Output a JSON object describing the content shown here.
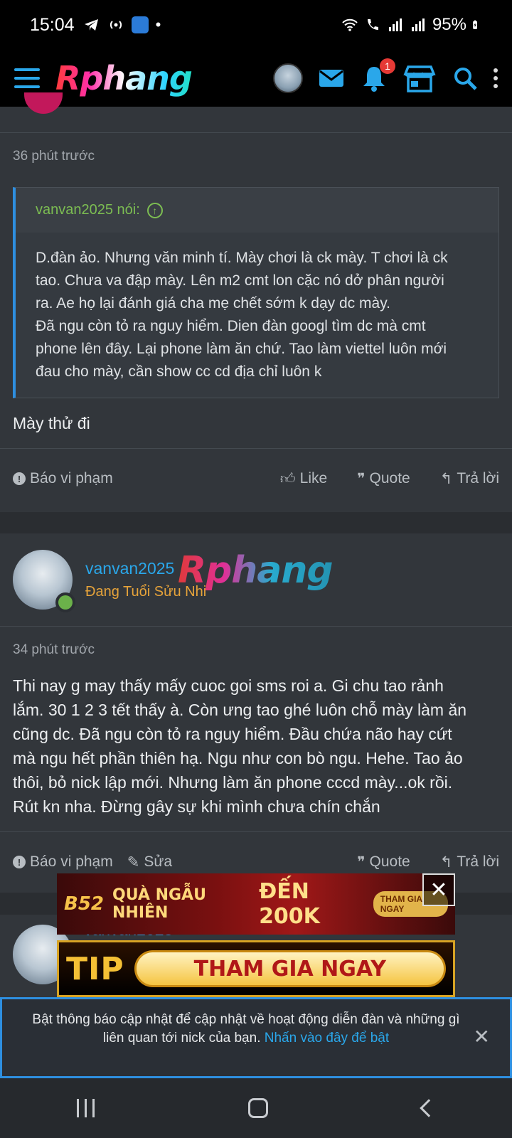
{
  "status_bar": {
    "time": "15:04",
    "battery": "95%"
  },
  "header": {
    "logo": "Rphang",
    "notification_count": "1"
  },
  "post1": {
    "time": "36 phút trước",
    "quote_author": "vanvan2025 nói:",
    "quote_lines": [
      "D.đàn ảo. Nhưng văn minh tí. Mày chơi là ck mày. T chơi là ck",
      "tao. Chưa va đập mày. Lên m2 cmt lon cặc nó dở phân người",
      "ra. Ae họ lại đánh giá cha mẹ chết sớm k dạy dc mày.",
      "Đã ngu còn tỏ ra nguy hiểm. Dien đàn googl tìm dc mà cmt",
      "phone lên đây. Lại phone làm ăn chứ. Tao làm viettel luôn mới",
      "đau cho mày, cần show cc cd địa chỉ luôn k"
    ],
    "message": "Mày thử đi",
    "report": "Báo vi phạm",
    "like": "Like",
    "quote": "Quote",
    "reply": "Trả lời"
  },
  "post2": {
    "username": "vanvan2025",
    "user_title": "Đang Tuổi Sửu Nhi",
    "watermark": "Rphang",
    "time": "34 phút trước",
    "message_lines": [
      "Thi nay g may thấy mấy cuoc goi sms roi a. Gi chu tao rảnh",
      "lắm. 30 1 2 3 tết thấy à. Còn ưng tao ghé luôn chỗ mày làm ăn",
      "cũng dc. Đã ngu còn tỏ ra nguy hiểm. Đầu chứa não hay cứt",
      "mà ngu hết phần thiên hạ. Ngu như con bò ngu. Hehe. Tao ảo",
      "thôi, bỏ nick lập mới. Nhưng làm ăn phone cccd mày...ok rồi.",
      "Rút kn nha. Đừng gây sự khi mình chưa chín chắn"
    ],
    "report": "Báo vi phạm",
    "edit": "Sửa",
    "quote": "Quote",
    "reply": "Trả lời"
  },
  "post3": {
    "username": "vanvan2025"
  },
  "ads": {
    "ad1": {
      "brand": "B52",
      "text": "QUÀ NGẪU NHIÊN",
      "amount": "ĐẾN 200K",
      "pill": "THAM GIA NGAY"
    },
    "ad2": {
      "brand": "TIP",
      "cta": "THAM GIA NGAY"
    }
  },
  "notification": {
    "text": "Bật thông báo cập nhật để cập nhật về hoạt động diễn đàn và những gì liên quan tới nick của bạn.",
    "link": "Nhấn vào đây để bật"
  },
  "colors": {
    "accent": "#2aa7ea",
    "quote_author": "#7cbd52",
    "user_title": "#e6a33a",
    "background": "#2a2d31"
  }
}
